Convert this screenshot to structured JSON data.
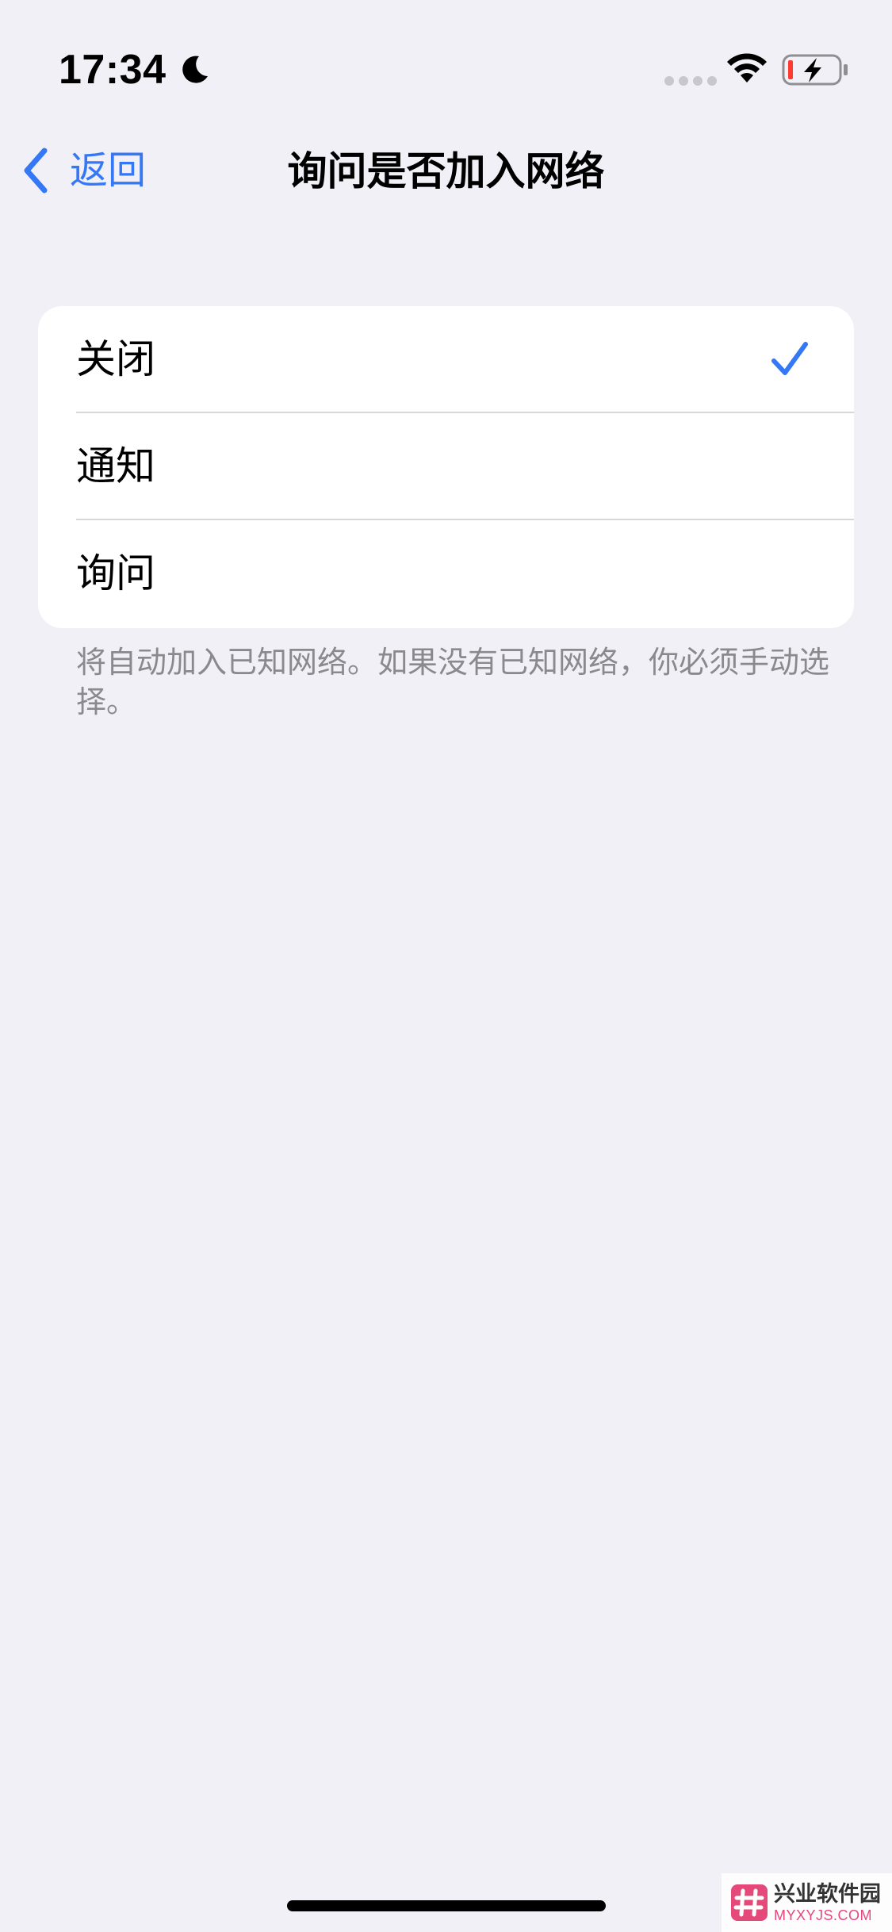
{
  "status_bar": {
    "time": "17:34",
    "moon_icon": "moon-icon",
    "wifi_icon": "wifi-icon",
    "battery_icon": "battery-charging-low-icon"
  },
  "nav": {
    "back_label": "返回",
    "title": "询问是否加入网络"
  },
  "options": [
    {
      "label": "关闭",
      "selected": true
    },
    {
      "label": "通知",
      "selected": false
    },
    {
      "label": "询问",
      "selected": false
    }
  ],
  "footer_note": "将自动加入已知网络。如果没有已知网络，你必须手动选择。",
  "colors": {
    "accent": "#3478f6",
    "background": "#f0f0f6",
    "card": "#ffffff",
    "secondary_text": "#8a8a8e"
  },
  "watermark": {
    "line1": "兴业软件园",
    "line2": "MYXYJS.COM"
  }
}
